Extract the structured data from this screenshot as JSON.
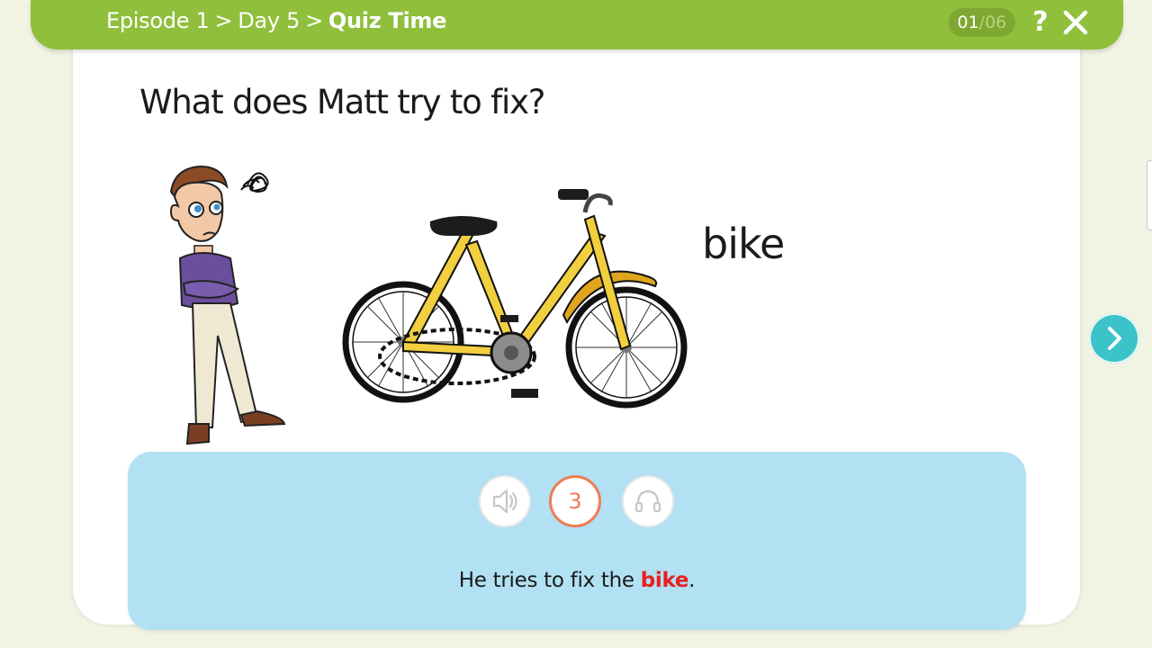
{
  "header": {
    "breadcrumb": [
      "Episode 1",
      "Day 5"
    ],
    "separator": ">",
    "current": "Quiz Time",
    "progress_current": "01",
    "progress_sep": "/",
    "progress_total": "06",
    "help_label": "?"
  },
  "question": {
    "text": "What does Matt try to fix?",
    "answer_word": "bike"
  },
  "panel": {
    "count": "3",
    "sentence_before": "He tries to fix the ",
    "sentence_highlight": "bike",
    "sentence_after": "."
  },
  "colors": {
    "header": "#8fbf3b",
    "panel": "#b1e1f2",
    "accent": "#f07b56",
    "highlight": "#e8201f",
    "next": "#3cc2c9"
  },
  "icons": [
    "help-icon",
    "close-icon",
    "speaker-icon",
    "headphones-icon",
    "chevron-right-icon"
  ]
}
